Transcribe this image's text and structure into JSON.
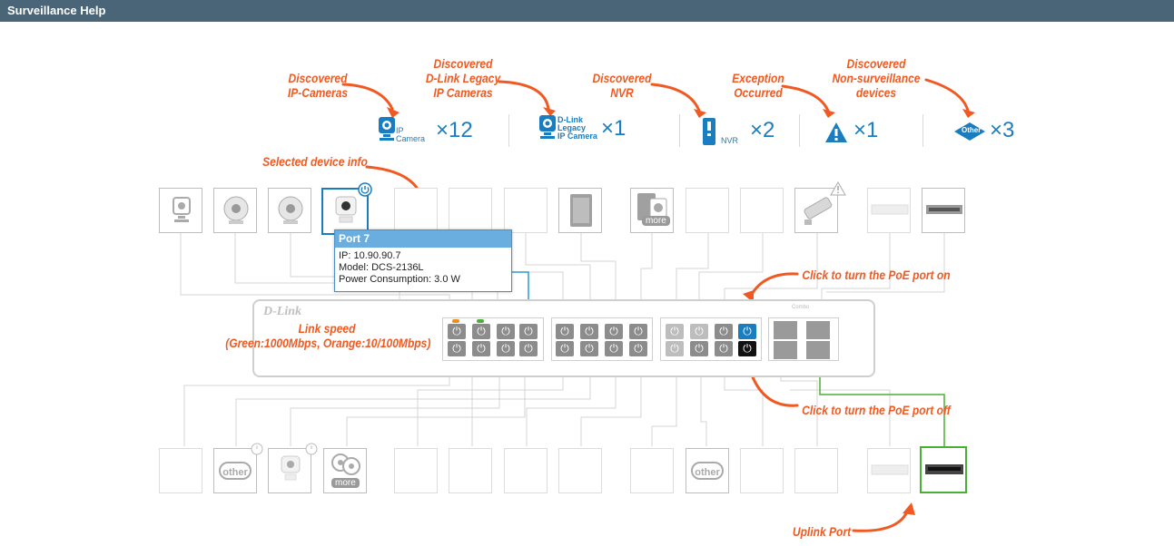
{
  "window": {
    "title": "Surveillance Help"
  },
  "legend": {
    "ip_camera": {
      "label_line1": "Discovered",
      "label_line2": "IP-Cameras",
      "icon_text_1": "IP",
      "icon_text_2": "Camera",
      "count": "×12"
    },
    "legacy_camera": {
      "label_line1": "Discovered",
      "label_line2": "D-Link Legacy",
      "label_line3": "IP Cameras",
      "icon_text_1": "D-Link",
      "icon_text_2": "Legacy",
      "icon_text_3": "IP Camera",
      "count": "×1"
    },
    "nvr": {
      "label_line1": "Discovered",
      "label_line2": "NVR",
      "icon_text": "NVR",
      "count": "×2"
    },
    "exception": {
      "label_line1": "Exception",
      "label_line2": "Occurred",
      "count": "×1"
    },
    "non_surveillance": {
      "label_line1": "Discovered",
      "label_line2": "Non-surveillance",
      "label_line3": "devices",
      "icon_text": "Other",
      "count": "×3"
    }
  },
  "annotations": {
    "selected_device_info": "Selected device info",
    "link_speed_1": "Link speed",
    "link_speed_2": "(Green:1000Mbps, Orange:10/100Mbps)",
    "poe_on": "Click to turn the PoE port on",
    "poe_off": "Click to turn the PoE port off",
    "uplink_port": "Uplink Port"
  },
  "popup": {
    "title": "Port 7",
    "ip": "IP: 10.90.90.7",
    "model": "Model: DCS-2136L",
    "power": "Power Consumption: 3.0 W"
  },
  "switch": {
    "brand": "D-Link",
    "combo_label": "Combo"
  },
  "badges": {
    "other": "other",
    "more": "more"
  },
  "colors": {
    "accent": "#f05a22",
    "primary": "#1a7dc0",
    "titlebar": "#4b6578",
    "link_green": "#4caf35",
    "link_orange": "#f08c1e"
  }
}
